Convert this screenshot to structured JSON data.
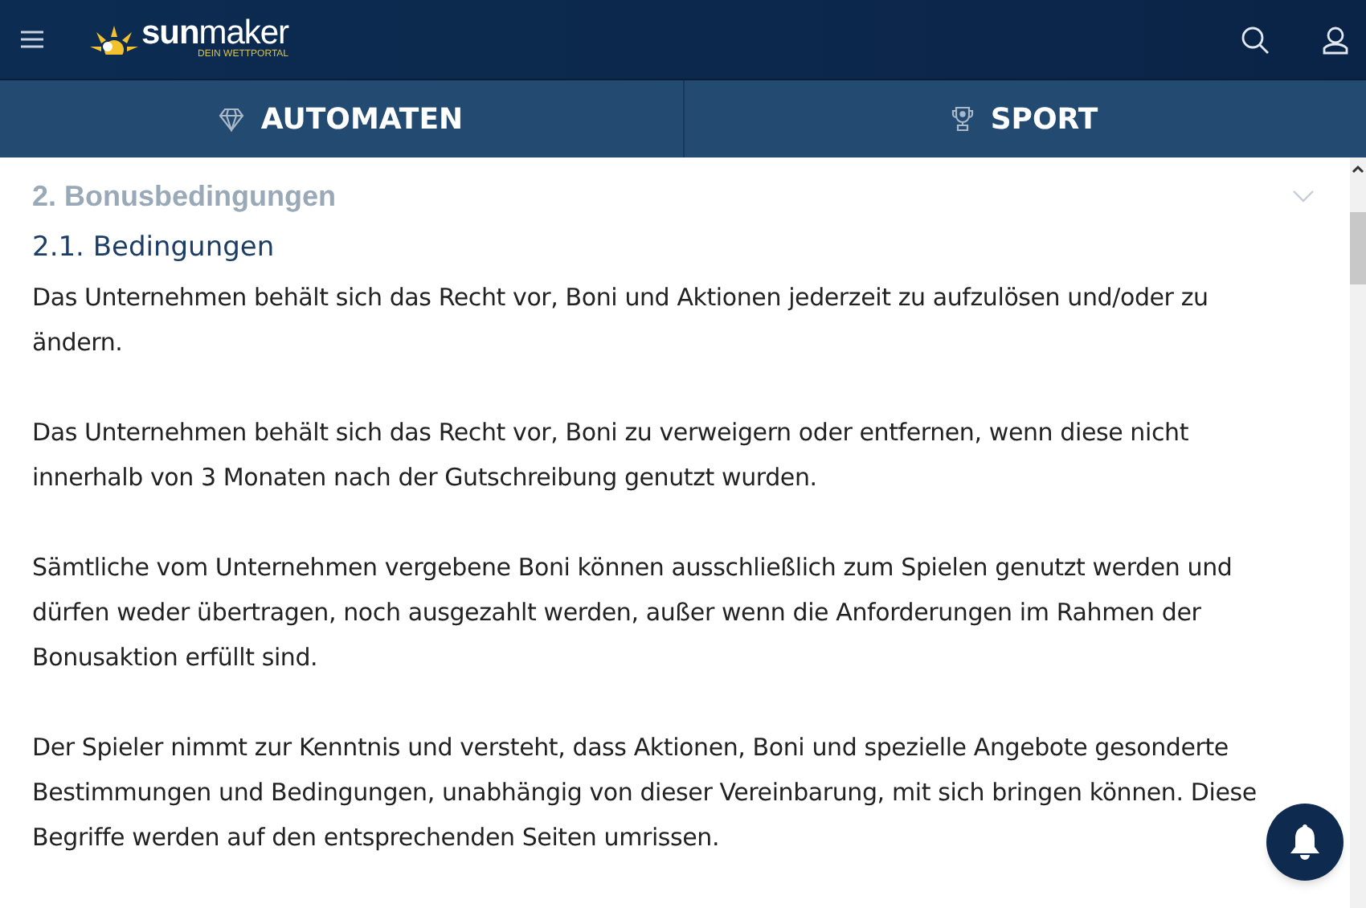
{
  "header": {
    "logo": "**sun**maker",
    "tagline": "DEIN WETTPORTAL"
  },
  "tabs": [
    {
      "label": "AUTOMATEN",
      "kind": "diamond",
      "selected": false
    },
    {
      "label": "SPORT",
      "kind": "trophy",
      "selected": false
    }
  ],
  "section": {
    "title": "2. Bonusbedingungen",
    "expanded": true
  },
  "subsection": {
    "title": "2.1. Bedingungen"
  },
  "paragraphs": [
    "Das Unternehmen behält sich das Recht vor, Boni und Aktionen jederzeit zu aufzulösen und/oder zu ändern.",
    "Das Unternehmen behält sich das Recht vor, Boni zu verweigern oder entfernen, wenn diese nicht innerhalb von 3 Monaten nach der Gutschreibung genutzt wurden.",
    "Sämtliche vom Unternehmen vergebene Boni können ausschließlich zum Spielen genutzt werden und dürfen weder übertragen, noch ausgezahlt werden, außer wenn die Anforderungen im Rahmen der Bonusaktion erfüllt sind.",
    "Der Spieler nimmt zur Kenntnis und versteht, dass Aktionen, Boni und spezielle Angebote gesonderte Bestimmungen und Bedingungen, unabhängig von dieser Vereinbarung, mit sich bringen können. Diese Begriffe werden auf den entsprechenden Seiten umrissen."
  ]
}
